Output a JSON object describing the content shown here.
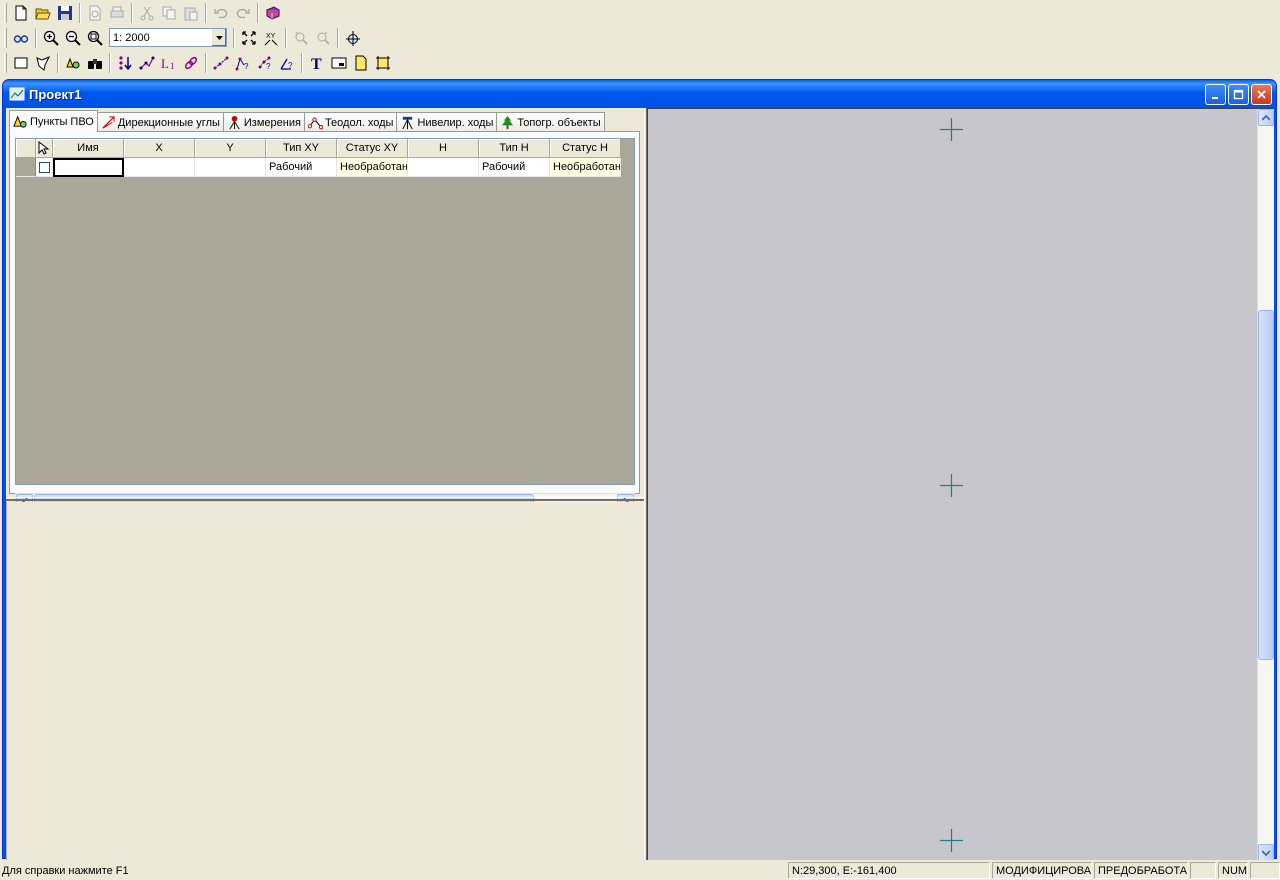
{
  "toolbar": {
    "scale_value": "1: 2000"
  },
  "window": {
    "title": "Проект1"
  },
  "tabs": [
    {
      "label": "Пункты ПВО",
      "icon": "points-icon"
    },
    {
      "label": "Дирекционные углы",
      "icon": "direction-angles-icon"
    },
    {
      "label": "Измерения",
      "icon": "measurements-icon"
    },
    {
      "label": "Теодол. ходы",
      "icon": "theodolite-traverse-icon"
    },
    {
      "label": "Нивелир. ходы",
      "icon": "leveling-traverse-icon"
    },
    {
      "label": "Топогр. объекты",
      "icon": "tree-icon"
    }
  ],
  "grid": {
    "headers": [
      "Имя",
      "X",
      "Y",
      "Тип XY",
      "Статус XY",
      "H",
      "Тип H",
      "Статус H"
    ],
    "rows": [
      {
        "name": "",
        "x": "",
        "y": "",
        "type_xy": "Рабочий",
        "status_xy": "Необработанн",
        "h": "",
        "type_h": "Рабочий",
        "status_h": "Необработанн"
      }
    ]
  },
  "statusbar": {
    "help": "Для справки  нажмите  F1",
    "coords": "N:29,300, E:-161,400",
    "state1": "МОДИФИЦИРОВАН",
    "state2": "ПРЕДОБРАБОТАН",
    "empty": "",
    "num": "NUM"
  },
  "colors": {
    "title_blue": "#0054e3",
    "map_bg": "#c7c6cc",
    "cross": "#1f7f86",
    "grid_empty": "#aca899",
    "status_yellow": "#ffffe1"
  }
}
